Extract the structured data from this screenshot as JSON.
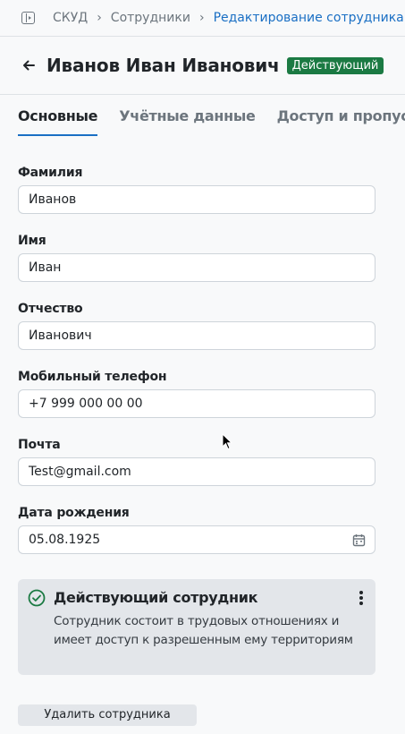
{
  "breadcrumb": {
    "items": [
      "СКУД",
      "Сотрудники"
    ],
    "current": "Редактирование сотрудника"
  },
  "header": {
    "name": "Иванов Иван Иванович",
    "status": "Действующий"
  },
  "tabs": [
    {
      "label": "Основные",
      "active": true
    },
    {
      "label": "Учётные данные",
      "active": false
    },
    {
      "label": "Доступ и пропуск",
      "active": false
    }
  ],
  "form": {
    "last_name": {
      "label": "Фамилия",
      "value": "Иванов"
    },
    "first_name": {
      "label": "Имя",
      "value": "Иван"
    },
    "middle_name": {
      "label": "Отчество",
      "value": "Иванович"
    },
    "phone": {
      "label": "Мобильный телефон",
      "value": "+7 999 000 00 00"
    },
    "email": {
      "label": "Почта",
      "value": "Test@gmail.com"
    },
    "birth_date": {
      "label": "Дата рождения",
      "value": "05.08.1925"
    }
  },
  "status_card": {
    "title": "Действующий сотрудник",
    "description": "Сотрудник состоит в трудовых отношениях и имеет доступ к разрешенным ему территориям"
  },
  "actions": {
    "delete_label": "Удалить сотрудника"
  },
  "colors": {
    "accent": "#1a6fc4",
    "status_badge": "#1b7a43",
    "status_icon": "#1b7a43"
  }
}
